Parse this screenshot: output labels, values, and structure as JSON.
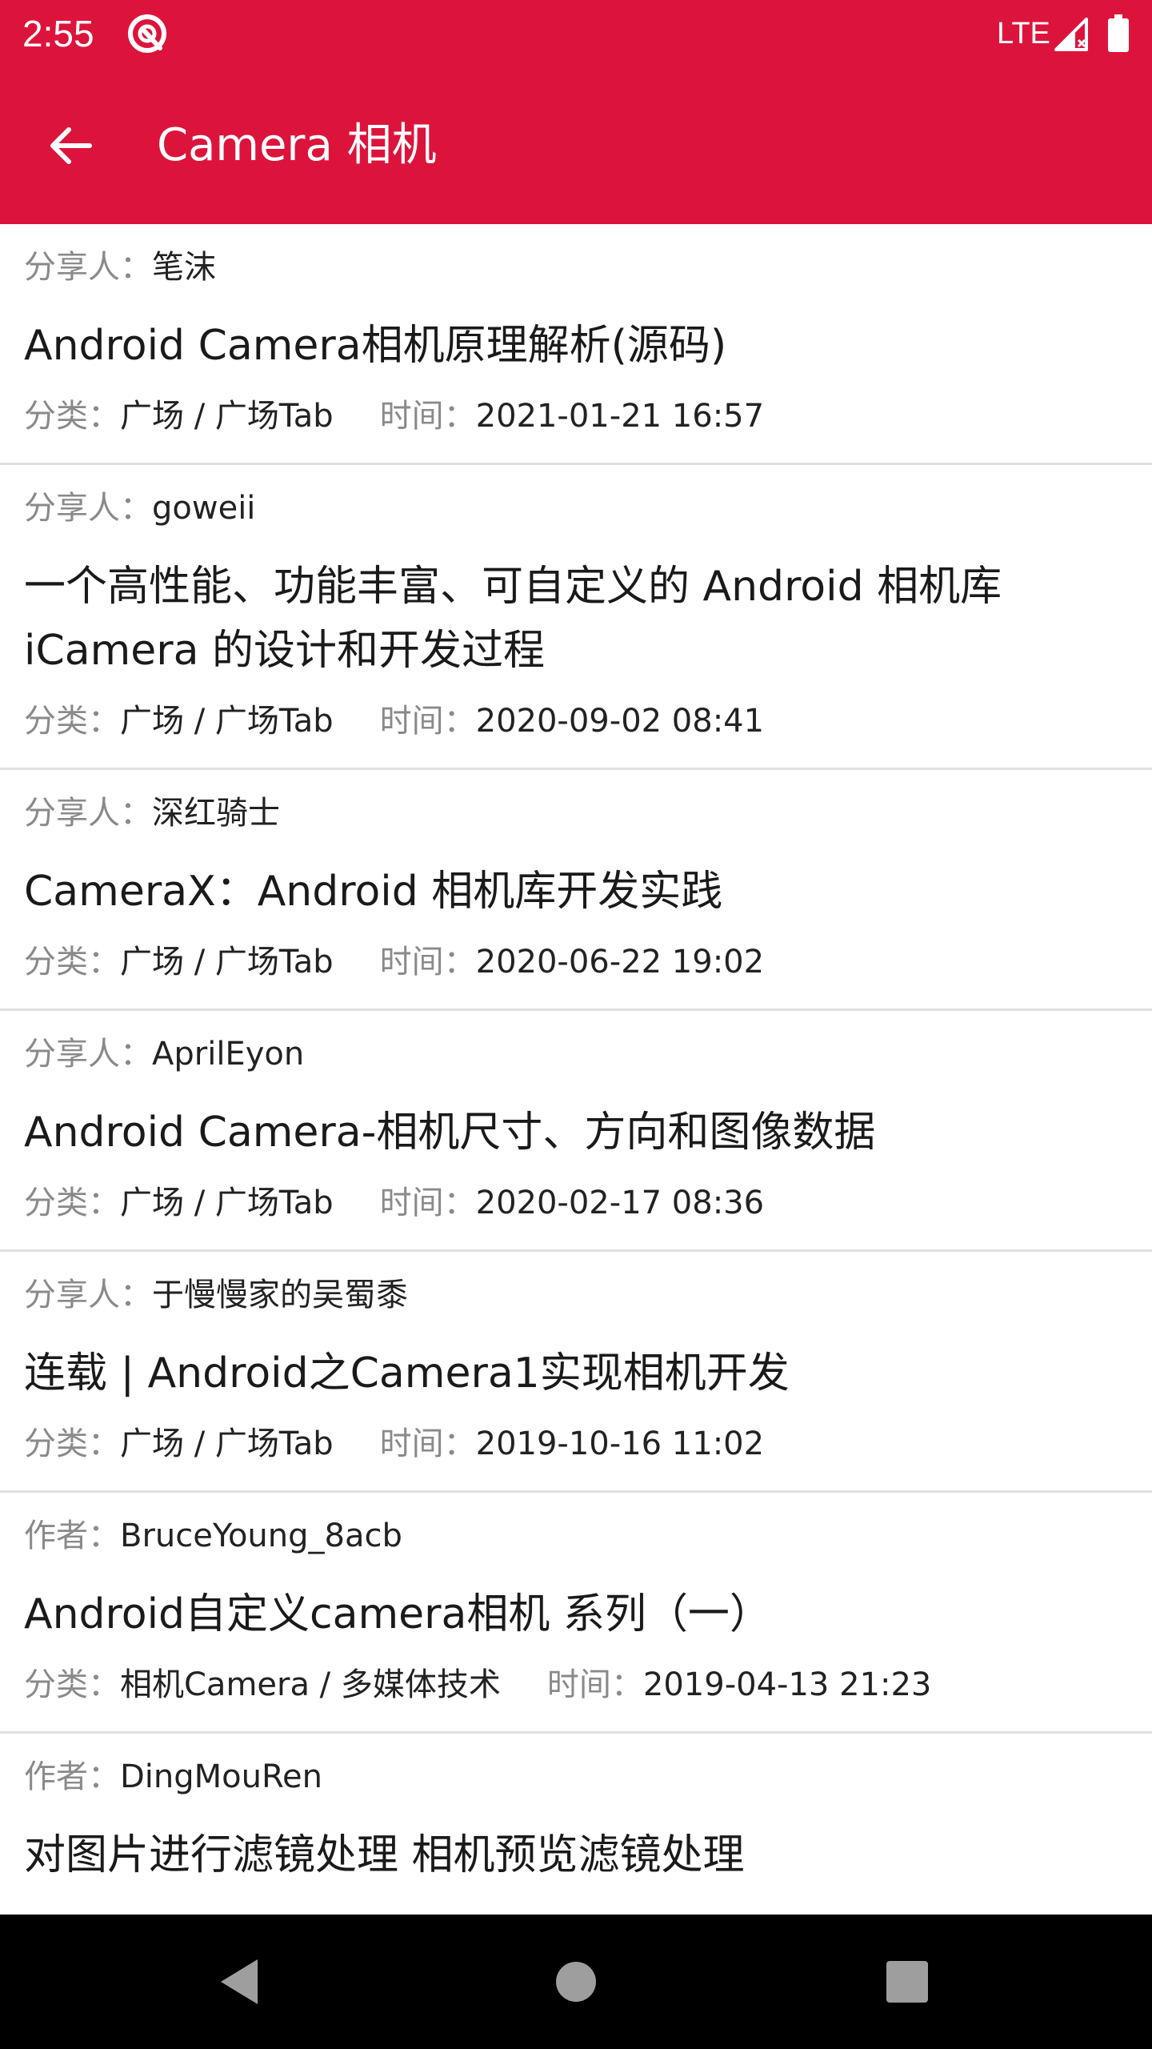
{
  "colors": {
    "primary": "#DC143C",
    "nav_bar": "#000000",
    "label_gray": "#8a8a8a",
    "divider": "#e0e0e0"
  },
  "status_bar": {
    "time": "2:55",
    "network": "LTE",
    "icons": [
      "app-notification-icon",
      "signal-icon",
      "battery-icon"
    ]
  },
  "app_bar": {
    "title": "Camera 相机",
    "back_icon": "arrow-back-icon"
  },
  "articles": [
    {
      "author_label": "分享人：",
      "author": "笔沫",
      "title": "Android Camera相机原理解析(源码)",
      "category_label": "分类：",
      "category": "广场 / 广场Tab",
      "time_label": "时间：",
      "time": "2021-01-21 16:57"
    },
    {
      "author_label": "分享人：",
      "author": "goweii",
      "title": "一个高性能、功能丰富、可自定义的 Android 相机库 iCamera 的设计和开发过程",
      "category_label": "分类：",
      "category": "广场 / 广场Tab",
      "time_label": "时间：",
      "time": "2020-09-02 08:41"
    },
    {
      "author_label": "分享人：",
      "author": "深红骑士",
      "title": "CameraX：Android 相机库开发实践",
      "category_label": "分类：",
      "category": "广场 / 广场Tab",
      "time_label": "时间：",
      "time": "2020-06-22 19:02"
    },
    {
      "author_label": "分享人：",
      "author": "AprilEyon",
      "title": "Android Camera-相机尺寸、方向和图像数据",
      "category_label": "分类：",
      "category": "广场 / 广场Tab",
      "time_label": "时间：",
      "time": "2020-02-17 08:36"
    },
    {
      "author_label": "分享人：",
      "author": "于慢慢家的吴蜀黍",
      "title": "连载 | Android之Camera1实现相机开发",
      "category_label": "分类：",
      "category": "广场 / 广场Tab",
      "time_label": "时间：",
      "time": "2019-10-16 11:02"
    },
    {
      "author_label": "作者：",
      "author": "BruceYoung_8acb",
      "title": "Android自定义camera相机 系列（一）",
      "category_label": "分类：",
      "category": "相机Camera / 多媒体技术",
      "time_label": "时间：",
      "time": "2019-04-13 21:23"
    },
    {
      "author_label": "作者：",
      "author": "DingMouRen",
      "title": "对图片进行滤镜处理 相机预览滤镜处理",
      "category_label": "",
      "category": "",
      "time_label": "",
      "time": ""
    }
  ],
  "nav_bar": {
    "buttons": [
      "nav-back-icon",
      "nav-home-icon",
      "nav-recents-icon"
    ]
  }
}
